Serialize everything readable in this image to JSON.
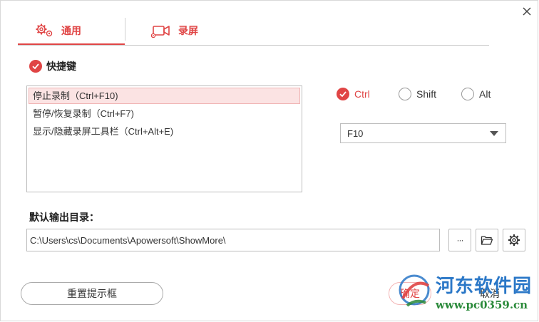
{
  "tabs": [
    {
      "label": "通用",
      "icon": "gears-icon",
      "active": true
    },
    {
      "label": "录屏",
      "icon": "camera-icon",
      "active": false
    }
  ],
  "shortcut_section": {
    "title": "快捷键",
    "enabled": true
  },
  "hotkeys": [
    {
      "label": "停止录制（Ctrl+F10)",
      "selected": true
    },
    {
      "label": "暂停/恢复录制（Ctrl+F7)",
      "selected": false
    },
    {
      "label": "显示/隐藏录屏工具栏（Ctrl+Alt+E)",
      "selected": false
    }
  ],
  "modifiers": [
    {
      "label": "Ctrl",
      "checked": true
    },
    {
      "label": "Shift",
      "checked": false
    },
    {
      "label": "Alt",
      "checked": false
    }
  ],
  "key_select": {
    "value": "F10"
  },
  "output": {
    "label": "默认输出目录：",
    "path": "C:\\Users\\cs\\Documents\\Apowersoft\\ShowMore\\"
  },
  "buttons": {
    "more_label": "···",
    "reset_label": "重置提示框",
    "ok_label": "确定",
    "cancel_label": "取消"
  },
  "watermark": {
    "name": "河东软件园",
    "url": "www.pc0359.cn"
  },
  "colors": {
    "accent": "#e04545",
    "border": "#bdbdbd",
    "selected_bg": "#fbe3e3"
  }
}
